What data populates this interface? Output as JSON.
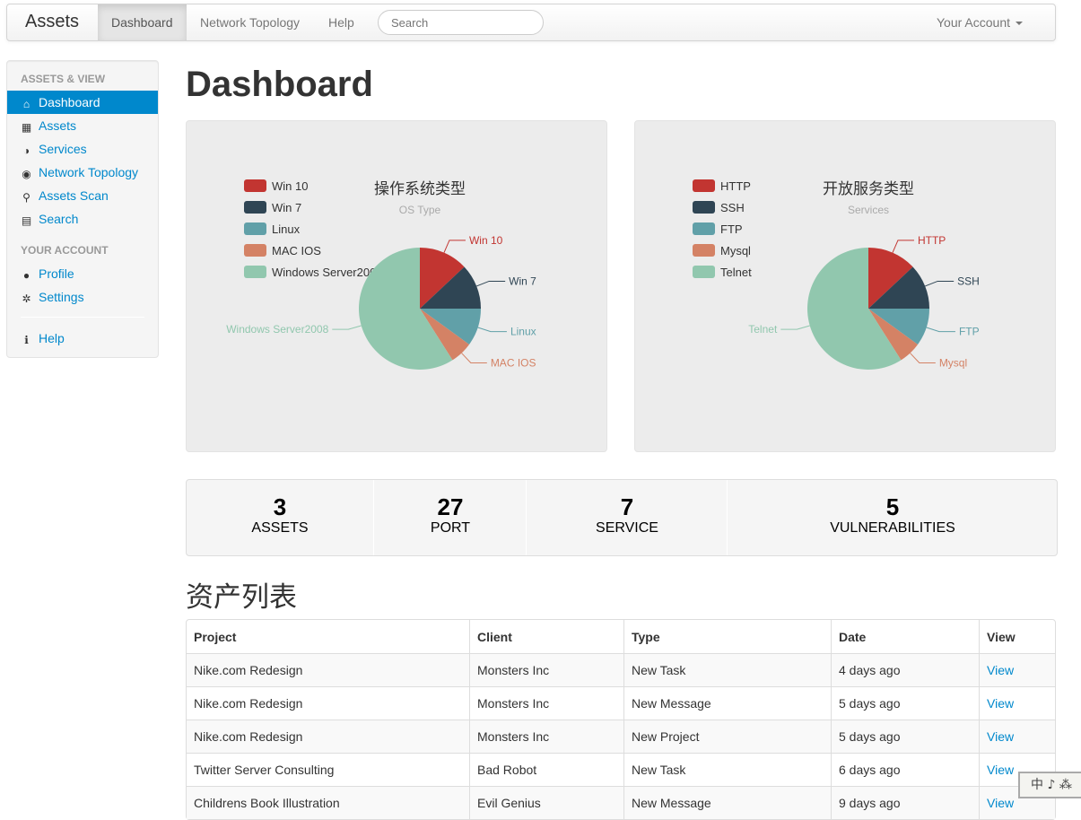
{
  "navbar": {
    "brand": "Assets",
    "items": [
      "Dashboard",
      "Network Topology",
      "Help"
    ],
    "search_placeholder": "Search",
    "account": "Your Account"
  },
  "sidebar": {
    "header1": "ASSETS & VIEW",
    "items1": [
      {
        "label": "Dashboard",
        "icon": "home-icon"
      },
      {
        "label": "Assets",
        "icon": "th-large-icon"
      },
      {
        "label": "Services",
        "icon": "adjust-icon"
      },
      {
        "label": "Network Topology",
        "icon": "eye-icon"
      },
      {
        "label": "Assets Scan",
        "icon": "search-icon"
      },
      {
        "label": "Search",
        "icon": "list-icon"
      }
    ],
    "header2": "YOUR ACCOUNT",
    "items2": [
      {
        "label": "Profile",
        "icon": "user-icon"
      },
      {
        "label": "Settings",
        "icon": "cog-icon"
      }
    ],
    "help": "Help"
  },
  "page": {
    "title": "Dashboard",
    "table_title": "资产列表"
  },
  "colors": {
    "series": [
      "#c23531",
      "#2f4554",
      "#61a0a8",
      "#d48265",
      "#91c7ae"
    ],
    "accent": "#0088cc"
  },
  "chart_data": [
    {
      "type": "pie",
      "title": "操作系统类型",
      "subtitle": "OS Type",
      "legend": "top-left",
      "categories": [
        "Win 10",
        "Win 7",
        "Linux",
        "MAC IOS",
        "Windows Server2008"
      ],
      "values": [
        13,
        12,
        10,
        6,
        59
      ]
    },
    {
      "type": "pie",
      "title": "开放服务类型",
      "subtitle": "Services",
      "legend": "top-left",
      "categories": [
        "HTTP",
        "SSH",
        "FTP",
        "Mysql",
        "Telnet"
      ],
      "values": [
        13,
        12,
        10,
        6,
        59
      ]
    }
  ],
  "stats": [
    {
      "value": "3",
      "label": "ASSETS"
    },
    {
      "value": "27",
      "label": "PORT"
    },
    {
      "value": "7",
      "label": "SERVICE"
    },
    {
      "value": "5",
      "label": "VULNERABILITIES"
    }
  ],
  "table": {
    "headers": [
      "Project",
      "Client",
      "Type",
      "Date",
      "View"
    ],
    "rows": [
      [
        "Nike.com Redesign",
        "Monsters Inc",
        "New Task",
        "4 days ago",
        "View"
      ],
      [
        "Nike.com Redesign",
        "Monsters Inc",
        "New Message",
        "5 days ago",
        "View"
      ],
      [
        "Nike.com Redesign",
        "Monsters Inc",
        "New Project",
        "5 days ago",
        "View"
      ],
      [
        "Twitter Server Consulting",
        "Bad Robot",
        "New Task",
        "6 days ago",
        "View"
      ],
      [
        "Childrens Book Illustration",
        "Evil Genius",
        "New Message",
        "9 days ago",
        "View"
      ]
    ]
  },
  "watermark": "中 ♪ ⁂"
}
